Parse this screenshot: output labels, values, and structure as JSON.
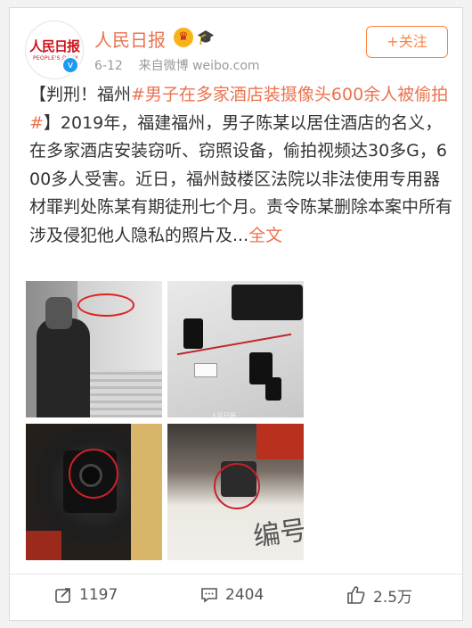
{
  "account": {
    "name": "人民日报",
    "logo_text": "人民日报",
    "logo_subtext": "PEOPLE'S DAILY",
    "verified_mark": "v",
    "badges": [
      "crown-icon",
      "graduation-cap-icon"
    ]
  },
  "post": {
    "date": "6-12",
    "source": "来自微博 weibo.com",
    "prefix": "【判刑！福州",
    "hashtag": "#男子在多家酒店装摄像头600余人被偷拍#",
    "body": "】2019年，福建福州，男子陈某以居住酒店的名义，在多家酒店安装窃听、窃照设备，偷拍视频达30多G，600多人受害。近日，福州鼓楼区法院以非法使用专用器材罪判处陈某有期徒刑七个月。责令陈某删除本案中所有涉及侵犯他人隐私的照片及...",
    "more_link": "全文",
    "handwriting": "编号",
    "image_watermark": "人民日报"
  },
  "follow_button": "+关注",
  "actions": {
    "forward_count": "1197",
    "comment_count": "2404",
    "like_count": "2.5万"
  },
  "colors": {
    "accent": "#eb7350",
    "follow": "#ff8140",
    "verified": "#1d9bf0"
  }
}
